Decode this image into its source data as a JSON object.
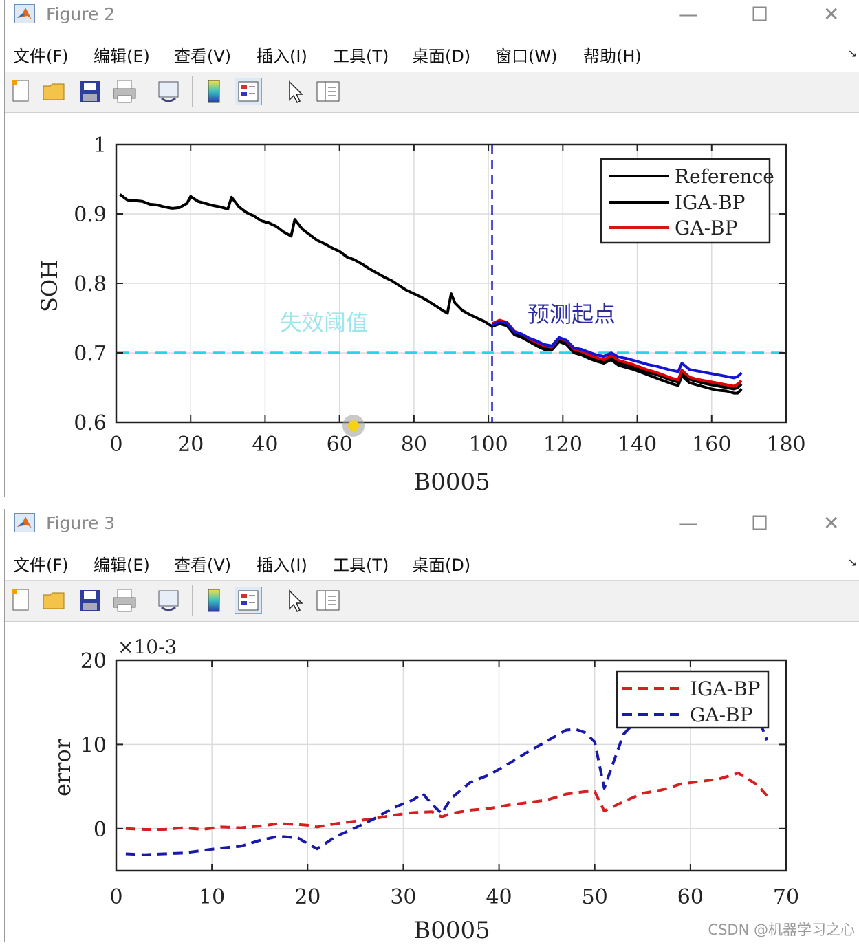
{
  "windows": [
    {
      "title": "Figure 2",
      "menu": [
        "文件(F)",
        "编辑(E)",
        "查看(V)",
        "插入(I)",
        "工具(T)",
        "桌面(D)",
        "窗口(W)",
        "帮助(H)"
      ],
      "toolbar_icons": [
        "new-figure-icon",
        "open-file-icon",
        "save-icon",
        "print-icon",
        "link-plot-icon",
        "colorbar-icon",
        "legend-icon",
        "pointer-icon",
        "property-inspector-icon"
      ],
      "chart_data": {
        "type": "line",
        "xlabel": "B0005",
        "ylabel": "SOH",
        "xlim": [
          0,
          180
        ],
        "ylim": [
          0.6,
          1
        ],
        "xticks": [
          0,
          20,
          40,
          60,
          80,
          100,
          120,
          140,
          160,
          180
        ],
        "yticks": [
          0.6,
          0.7,
          0.8,
          0.9,
          1
        ],
        "grid": true,
        "legend_position": "top-right",
        "colors": {
          "reference": "#000000",
          "iga": "#000000",
          "ga": "#e00000",
          "pred": "#1515d0",
          "threshold": "#22d8e6",
          "start_line": "#1a1ac8"
        },
        "annotations": {
          "threshold_label": "失效阈值",
          "start_label": "预测起点"
        },
        "threshold": 0.7,
        "start_x": 101,
        "series": [
          {
            "name": "Reference",
            "x": [
              1,
              2,
              3,
              5,
              7,
              9,
              11,
              13,
              15,
              17,
              19,
              20,
              22,
              24,
              26,
              28,
              30,
              31,
              33,
              35,
              37,
              39,
              41,
              43,
              45,
              47,
              48,
              50,
              52,
              54,
              56,
              58,
              60,
              62,
              64,
              66,
              68,
              70,
              72,
              74,
              76,
              78,
              80,
              82,
              84,
              86,
              88,
              89,
              90,
              91,
              93,
              95,
              97,
              99,
              101,
              103,
              105,
              107,
              109,
              111,
              113,
              115,
              117,
              119,
              121,
              123,
              125,
              127,
              129,
              131,
              133,
              135,
              137,
              139,
              141,
              143,
              145,
              147,
              149,
              151,
              152,
              154,
              156,
              158,
              160,
              162,
              164,
              166,
              167,
              168
            ],
            "values": [
              0.928,
              0.924,
              0.92,
              0.919,
              0.918,
              0.914,
              0.913,
              0.91,
              0.908,
              0.909,
              0.915,
              0.925,
              0.918,
              0.915,
              0.912,
              0.91,
              0.907,
              0.924,
              0.91,
              0.902,
              0.897,
              0.89,
              0.887,
              0.882,
              0.874,
              0.868,
              0.892,
              0.878,
              0.87,
              0.862,
              0.857,
              0.851,
              0.846,
              0.838,
              0.834,
              0.828,
              0.821,
              0.815,
              0.809,
              0.804,
              0.797,
              0.79,
              0.785,
              0.78,
              0.774,
              0.767,
              0.76,
              0.757,
              0.785,
              0.772,
              0.761,
              0.755,
              0.75,
              0.745,
              0.738,
              0.742,
              0.739,
              0.726,
              0.722,
              0.716,
              0.71,
              0.705,
              0.704,
              0.716,
              0.712,
              0.7,
              0.697,
              0.692,
              0.688,
              0.685,
              0.69,
              0.682,
              0.679,
              0.676,
              0.672,
              0.668,
              0.664,
              0.66,
              0.656,
              0.653,
              0.667,
              0.657,
              0.654,
              0.651,
              0.648,
              0.646,
              0.645,
              0.642,
              0.642,
              0.648
            ]
          },
          {
            "name": "IGA-BP",
            "x": [
              101,
              103,
              105,
              107,
              109,
              111,
              113,
              115,
              117,
              119,
              121,
              123,
              125,
              127,
              129,
              131,
              133,
              135,
              137,
              139,
              141,
              143,
              145,
              147,
              149,
              151,
              152,
              154,
              156,
              158,
              160,
              162,
              164,
              166,
              167,
              168
            ],
            "values": [
              0.741,
              0.745,
              0.742,
              0.729,
              0.725,
              0.718,
              0.713,
              0.708,
              0.706,
              0.719,
              0.715,
              0.703,
              0.7,
              0.695,
              0.691,
              0.688,
              0.694,
              0.686,
              0.683,
              0.68,
              0.676,
              0.672,
              0.669,
              0.665,
              0.661,
              0.658,
              0.672,
              0.662,
              0.659,
              0.656,
              0.654,
              0.652,
              0.65,
              0.648,
              0.65,
              0.655
            ]
          },
          {
            "name": "GA-BP",
            "x": [
              101,
              103,
              105,
              107,
              109,
              111,
              113,
              115,
              117,
              119,
              121,
              123,
              125,
              127,
              129,
              131,
              133,
              135,
              137,
              139,
              141,
              143,
              145,
              147,
              149,
              151,
              152,
              154,
              156,
              158,
              160,
              162,
              164,
              166,
              167,
              168
            ],
            "values": [
              0.742,
              0.747,
              0.744,
              0.731,
              0.727,
              0.72,
              0.715,
              0.71,
              0.708,
              0.721,
              0.717,
              0.705,
              0.702,
              0.697,
              0.693,
              0.69,
              0.696,
              0.689,
              0.686,
              0.683,
              0.679,
              0.675,
              0.672,
              0.668,
              0.664,
              0.661,
              0.675,
              0.665,
              0.662,
              0.66,
              0.658,
              0.656,
              0.654,
              0.652,
              0.655,
              0.66
            ]
          },
          {
            "name": "",
            "x": [
              101,
              103,
              105,
              107,
              109,
              111,
              113,
              115,
              117,
              119,
              121,
              123,
              125,
              127,
              129,
              131,
              133,
              135,
              137,
              139,
              141,
              143,
              145,
              147,
              149,
              151,
              152,
              154,
              156,
              158,
              160,
              162,
              164,
              166,
              167,
              168
            ],
            "values": [
              0.74,
              0.745,
              0.743,
              0.73,
              0.727,
              0.721,
              0.717,
              0.712,
              0.71,
              0.722,
              0.718,
              0.707,
              0.705,
              0.701,
              0.697,
              0.695,
              0.7,
              0.694,
              0.692,
              0.689,
              0.686,
              0.683,
              0.681,
              0.678,
              0.675,
              0.673,
              0.685,
              0.676,
              0.674,
              0.672,
              0.67,
              0.668,
              0.666,
              0.664,
              0.666,
              0.671
            ]
          }
        ]
      }
    },
    {
      "title": "Figure 3",
      "menu": [
        "文件(F)",
        "编辑(E)",
        "查看(V)",
        "插入(I)",
        "工具(T)",
        "桌面(D)"
      ],
      "toolbar_icons": [
        "new-figure-icon",
        "open-file-icon",
        "save-icon",
        "print-icon",
        "link-plot-icon",
        "colorbar-icon",
        "legend-icon",
        "pointer-icon",
        "property-inspector-icon"
      ],
      "chart_data": {
        "type": "line",
        "xlabel": "B0005",
        "ylabel": "error",
        "y_multiplier": "×10-3",
        "xlim": [
          0,
          70
        ],
        "ylim": [
          -5,
          20
        ],
        "xticks": [
          0,
          10,
          20,
          30,
          40,
          50,
          60,
          70
        ],
        "yticks": [
          0,
          10,
          20
        ],
        "grid": true,
        "legend_position": "top-right",
        "colors": {
          "iga": "#d42020",
          "ga": "#1a1aa8"
        },
        "series": [
          {
            "name": "IGA-BP",
            "x": [
              1,
              3,
              5,
              7,
              9,
              11,
              13,
              15,
              17,
              19,
              20,
              21,
              23,
              25,
              27,
              29,
              31,
              33,
              34,
              35,
              37,
              39,
              41,
              43,
              45,
              47,
              49,
              50,
              51,
              53,
              55,
              57,
              59,
              61,
              63,
              65,
              67,
              68
            ],
            "values": [
              0,
              -0.1,
              -0.1,
              0.1,
              -0.1,
              0.2,
              0.1,
              0.3,
              0.6,
              0.5,
              0.4,
              0.2,
              0.6,
              0.9,
              1.2,
              1.6,
              1.9,
              2.0,
              1.4,
              1.8,
              2.2,
              2.4,
              2.8,
              3.1,
              3.4,
              4.1,
              4.4,
              4.4,
              2.1,
              3.2,
              4.2,
              4.6,
              5.3,
              5.6,
              5.9,
              6.6,
              5.2,
              3.9
            ]
          },
          {
            "name": "GA-BP",
            "x": [
              1,
              3,
              5,
              7,
              9,
              11,
              13,
              15,
              17,
              19,
              20,
              21,
              23,
              25,
              27,
              29,
              31,
              32,
              33,
              34,
              35,
              37,
              39,
              41,
              43,
              45,
              47,
              48,
              49,
              50,
              51,
              53,
              55,
              57,
              59,
              61,
              63,
              65,
              67,
              68
            ],
            "values": [
              -3,
              -3.1,
              -3,
              -2.9,
              -2.6,
              -2.3,
              -2.1,
              -1.4,
              -0.9,
              -1.1,
              -1.8,
              -2.4,
              -0.9,
              0.1,
              1.2,
              2.5,
              3.4,
              4.2,
              2.9,
              1.8,
              3.6,
              5.5,
              6.4,
              7.7,
              9.1,
              10.4,
              11.7,
              11.8,
              11.4,
              10.3,
              4.8,
              11.2,
              13.6,
              15.4,
              16.8,
              17.6,
              18.2,
              18.6,
              13.4,
              10.5
            ]
          }
        ]
      }
    }
  ],
  "watermark": "CSDN @机器学习之心"
}
